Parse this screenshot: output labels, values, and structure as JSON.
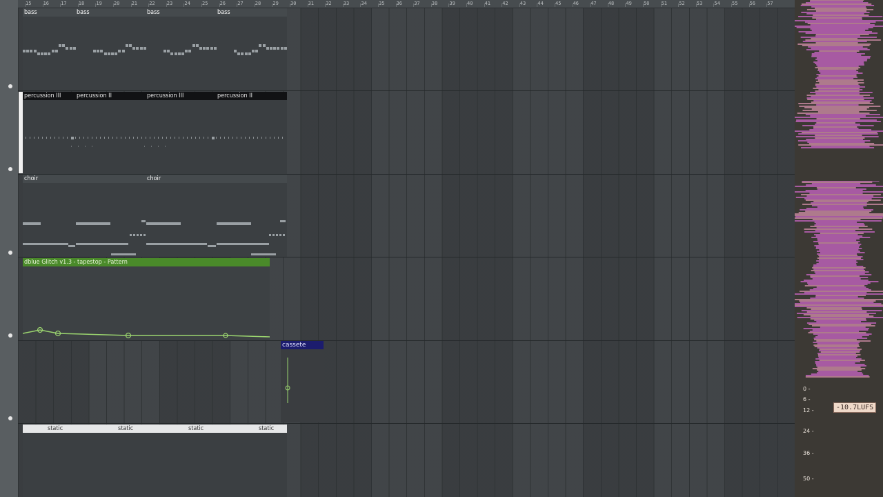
{
  "ruler": {
    "bars": [
      "15",
      "16",
      "17",
      "18",
      "19",
      "20",
      "21",
      "22",
      "23",
      "24",
      "25",
      "26",
      "27",
      "28",
      "29",
      "30",
      "31",
      "32",
      "33",
      "34",
      "35",
      "36",
      "37",
      "38",
      "39",
      "40",
      "41",
      "42",
      "43",
      "44",
      "45",
      "46",
      "47",
      "48",
      "49",
      "50",
      "51",
      "52",
      "53",
      "54",
      "55",
      "56",
      "57"
    ]
  },
  "tracks": {
    "bass": {
      "clips": [
        "bass",
        "bass",
        "bass",
        "bass"
      ]
    },
    "percussion": {
      "clips": [
        "percussion III",
        "percussion II",
        "percussion III",
        "percussion II"
      ]
    },
    "choir": {
      "clips": [
        "choir",
        "choir"
      ]
    },
    "automation": {
      "label": "dblue Glitch v1.3 - tapestop - Pattern"
    },
    "cassete": {
      "label": "cassete"
    },
    "static": {
      "clips": [
        "static",
        "static",
        "static",
        "static"
      ]
    }
  },
  "meter": {
    "loudness": "-10.7LUFS",
    "scale": [
      "0",
      "6",
      "12",
      "24",
      "36",
      "50"
    ],
    "colors": {
      "wave": "#e46fe0",
      "wave_alt": "#f0a0c0",
      "bar": "#f1d6c2"
    }
  }
}
